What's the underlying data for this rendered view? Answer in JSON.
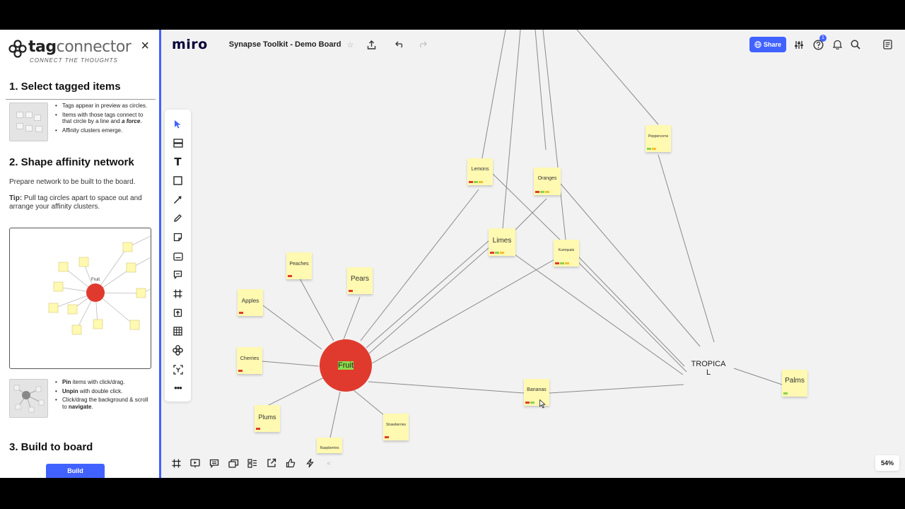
{
  "plugin": {
    "logo_main": "tag",
    "logo_rest": "connector",
    "tagline": "CONNECT THE THOUGHTS",
    "close_label": "×",
    "sections": {
      "s1_title": "1. Select tagged items",
      "s1_bullets": [
        "Tags appear in preview as circles.",
        "Items with those tags connect to that circle by a line and a force.",
        "Affinity clusters emerge."
      ],
      "s2_title": "2. Shape affinity network",
      "s2_text": "Prepare network to be built to the board.",
      "s2_tip_label": "Tip:",
      "s2_tip": " Pull tag circles apart to space out and arrange your affinity clusters.",
      "preview_center_label": "Fruit",
      "s2_bullets": [
        {
          "bold": "Pin",
          "rest": " items with click/drag."
        },
        {
          "bold": "Unpin",
          "rest": " with double click."
        },
        {
          "bold": "",
          "rest": "Click/drag the background & scroll to ",
          "bold2": "navigate",
          "rest2": "."
        }
      ],
      "s3_title": "3. Build to board",
      "build_label": "Build"
    }
  },
  "topbar": {
    "brand": "miro",
    "board_name": "Synapse Toolkit - Demo Board",
    "share_label": "Share",
    "notification_count": "1"
  },
  "zoom": "54%",
  "board": {
    "tag_circles": [
      {
        "id": "fruit",
        "label": "Fruit",
        "color": "#e03a2e"
      },
      {
        "id": "tropical",
        "label": "TROPICAL",
        "color": "#8cdb4a"
      }
    ],
    "stickies": [
      {
        "id": "lemons",
        "label": "Lemons",
        "tags": [
          "#e23b2e",
          "#8fd14f",
          "#f2c230"
        ]
      },
      {
        "id": "oranges",
        "label": "Oranges",
        "tags": [
          "#e23b2e",
          "#8fd14f",
          "#f2c230"
        ]
      },
      {
        "id": "peppercorns",
        "label": "Peppercorns",
        "tags": [
          "#8fd14f",
          "#f2c230"
        ]
      },
      {
        "id": "limes",
        "label": "Limes",
        "tags": [
          "#e23b2e",
          "#8fd14f",
          "#f2c230"
        ]
      },
      {
        "id": "kumquats",
        "label": "Kumquats",
        "tags": [
          "#e23b2e",
          "#8fd14f",
          "#f2c230"
        ]
      },
      {
        "id": "peaches",
        "label": "Peaches",
        "tags": [
          "#e23b2e"
        ]
      },
      {
        "id": "pears",
        "label": "Pears",
        "tags": [
          "#e23b2e"
        ]
      },
      {
        "id": "apples",
        "label": "Apples",
        "tags": [
          "#e23b2e"
        ]
      },
      {
        "id": "cherries",
        "label": "Cherries",
        "tags": [
          "#e23b2e"
        ]
      },
      {
        "id": "plums",
        "label": "Plums",
        "tags": [
          "#e23b2e"
        ]
      },
      {
        "id": "raspberries",
        "label": "Raspberries",
        "tags": []
      },
      {
        "id": "strawberries",
        "label": "Strawberries",
        "tags": [
          "#e23b2e"
        ]
      },
      {
        "id": "bananas",
        "label": "Bananas",
        "tags": [
          "#e23b2e",
          "#8fd14f"
        ]
      },
      {
        "id": "palms",
        "label": "Palms",
        "tags": [
          "#8fd14f"
        ]
      }
    ]
  }
}
